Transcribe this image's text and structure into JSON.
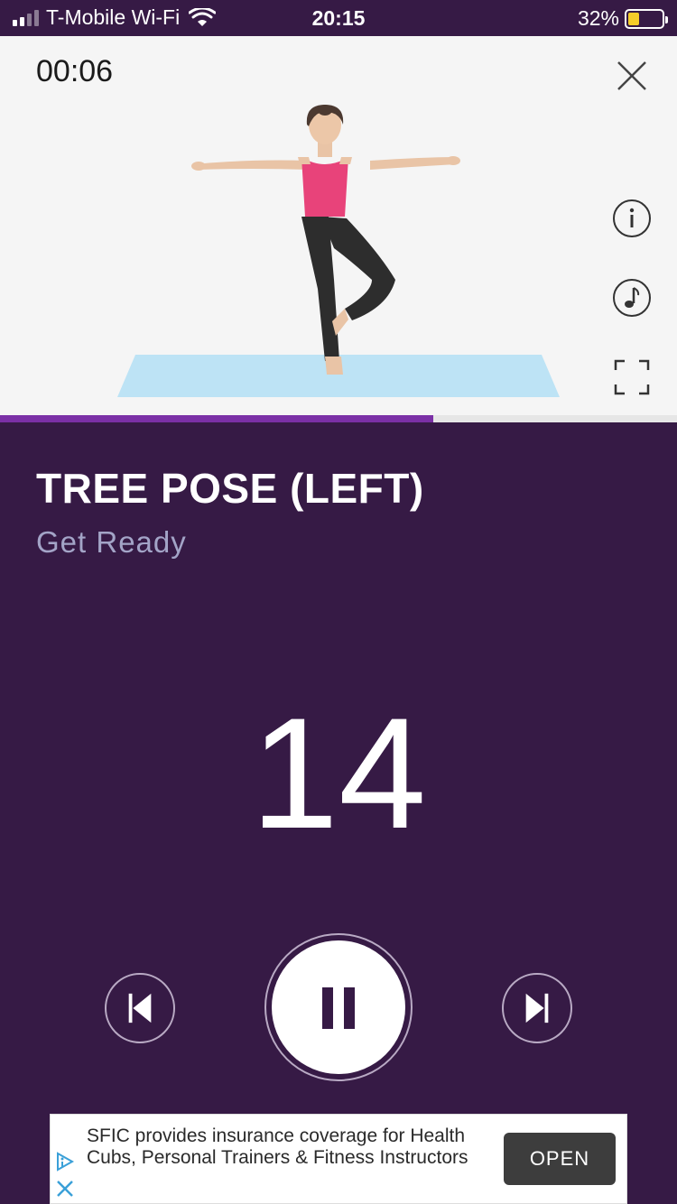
{
  "status_bar": {
    "carrier": "T-Mobile Wi-Fi",
    "time": "20:15",
    "battery_percent": "32%",
    "battery_level": 0.32,
    "icons": [
      "signal-icon",
      "wifi-icon",
      "battery-icon"
    ]
  },
  "player": {
    "elapsed": "00:06",
    "progress_fraction": 0.64,
    "colors": {
      "accent": "#7b30a6",
      "background": "#361a45",
      "panel": "#f5f5f5"
    }
  },
  "exercise": {
    "title": "TREE POSE (LEFT)",
    "status": "Get Ready",
    "countdown": "14"
  },
  "controls": {
    "icons": [
      "close-icon",
      "info-icon",
      "music-icon",
      "fullscreen-icon",
      "previous-icon",
      "pause-icon",
      "next-icon"
    ]
  },
  "ad": {
    "text": "SFIC provides insurance coverage for Health Cubs, Personal Trainers & Fitness Instructors",
    "button_label": "OPEN"
  }
}
